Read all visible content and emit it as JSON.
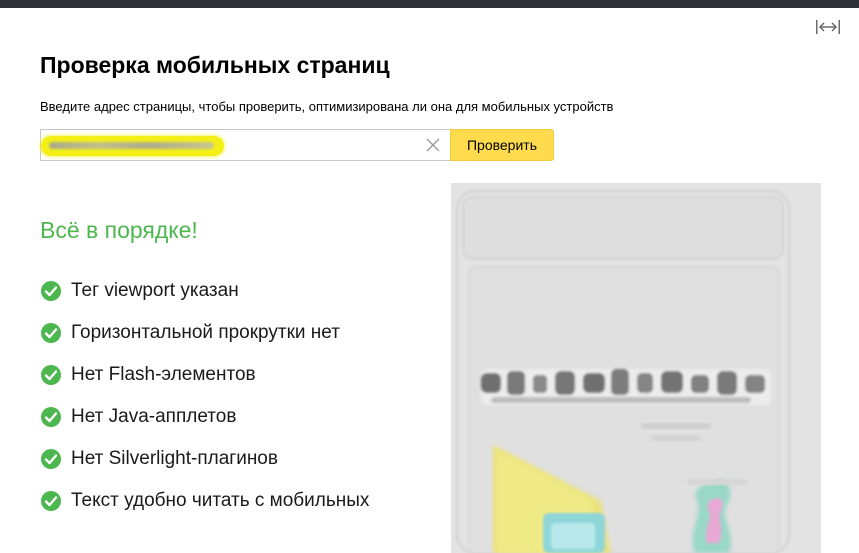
{
  "page": {
    "title": "Проверка мобильных страниц",
    "subtitle": "Введите адрес страницы, чтобы проверить, оптимизирована ли она для мобильных устройств"
  },
  "toolbar": {
    "expand_icon": "expand-horizontal-icon"
  },
  "url_form": {
    "value": "",
    "clear_icon": "close-icon",
    "submit_label": "Проверить",
    "submit_color": "#ffdb4d",
    "highlight_color": "#f4f017"
  },
  "result": {
    "title": "Всё в порядке!",
    "status_color": "#4cb74e",
    "checks": [
      {
        "label": "Тег viewport указан",
        "icon": "check-circle-icon"
      },
      {
        "label": "Горизонтальной прокрутки нет",
        "icon": "check-circle-icon"
      },
      {
        "label": "Нет Flash-элементов",
        "icon": "check-circle-icon"
      },
      {
        "label": "Нет Java-апплетов",
        "icon": "check-circle-icon"
      },
      {
        "label": "Нет Silverlight-плагинов",
        "icon": "check-circle-icon"
      },
      {
        "label": "Текст удобно читать с мобильных",
        "icon": "check-circle-icon"
      }
    ]
  }
}
